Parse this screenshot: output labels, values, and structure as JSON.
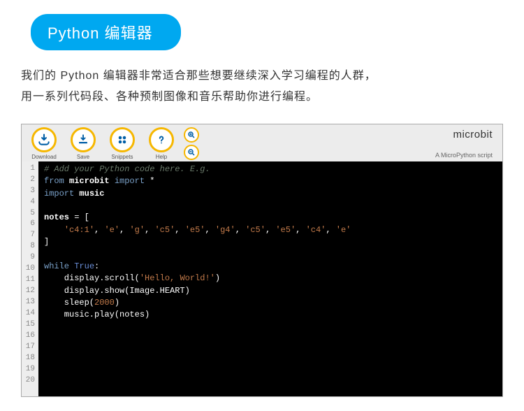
{
  "header": {
    "title": "Python 编辑器"
  },
  "intro": {
    "line1": "我们的 Python 编辑器非常适合那些想要继续深入学习编程的人群，",
    "line2": "用一系列代码段、各种预制图像和音乐帮助你进行编程。"
  },
  "toolbar": {
    "download": "Download",
    "save": "Save",
    "snippets": "Snippets",
    "help": "Help"
  },
  "brand": {
    "name": "microbit",
    "sub": "A MicroPython script"
  },
  "code": {
    "lines": [
      {
        "n": 1,
        "html": "<span class='cm'># Add your Python code here. E.g.</span>"
      },
      {
        "n": 2,
        "html": "<span class='kw'>from</span> <span class='id'>microbit</span> <span class='kw'>import</span> <span class='op'>*</span>"
      },
      {
        "n": 3,
        "html": "<span class='kw'>import</span> <span class='id'>music</span>"
      },
      {
        "n": 4,
        "html": ""
      },
      {
        "n": 5,
        "html": "<span class='id'>notes</span> <span class='op'>=</span> <span class='op'>[</span>"
      },
      {
        "n": 6,
        "html": "    <span class='st'>'c4:1'</span>, <span class='st'>'e'</span>, <span class='st'>'g'</span>, <span class='st'>'c5'</span>, <span class='st'>'e5'</span>, <span class='st'>'g4'</span>, <span class='st'>'c5'</span>, <span class='st'>'e5'</span>, <span class='st'>'c4'</span>, <span class='st'>'e'</span>"
      },
      {
        "n": 7,
        "html": "<span class='op'>]</span>"
      },
      {
        "n": 8,
        "html": ""
      },
      {
        "n": 9,
        "html": "<span class='kw'>while</span> <span class='bl'>True</span><span class='op'>:</span>"
      },
      {
        "n": 10,
        "html": "    display.scroll(<span class='st'>'Hello, World!'</span>)"
      },
      {
        "n": 11,
        "html": "    display.show(Image.HEART)"
      },
      {
        "n": 12,
        "html": "    sleep(<span class='nm'>2000</span>)"
      },
      {
        "n": 13,
        "html": "    music.play(notes)"
      },
      {
        "n": 14,
        "html": ""
      },
      {
        "n": 15,
        "html": ""
      },
      {
        "n": 16,
        "html": ""
      },
      {
        "n": 17,
        "html": ""
      },
      {
        "n": 18,
        "html": ""
      },
      {
        "n": 19,
        "html": ""
      },
      {
        "n": 20,
        "html": ""
      }
    ]
  }
}
